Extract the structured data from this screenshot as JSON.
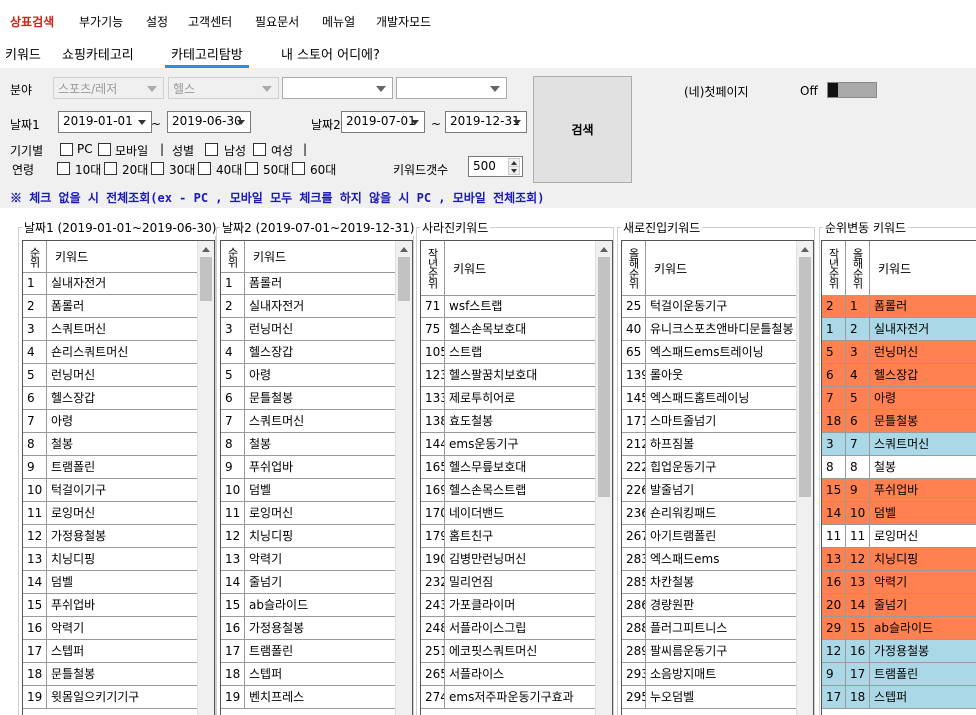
{
  "menu": [
    "상표검색",
    "부가기능",
    "설정",
    "고객센터",
    "필요문서",
    "메뉴얼",
    "개발자모드"
  ],
  "tabs": [
    "키워드",
    "쇼핑카테고리",
    "카테고리탐방",
    "내 스토어 어디에?"
  ],
  "form": {
    "field_label": "분야",
    "field1": "스포츠/레저",
    "field2": "헬스",
    "field3": "",
    "field4": "",
    "date1_label": "날짜1",
    "date1_from": "2019-01-01",
    "date1_to": "2019-06-30",
    "date2_label": "날짜2",
    "date2_from": "2019-07-01",
    "date2_to": "2019-12-31",
    "tilde": "~",
    "device_label": "기기별",
    "pc": "PC",
    "mobile": "모바일",
    "sep": "|",
    "gender_label": "성별",
    "male": "남성",
    "female": "여성",
    "age_label": "연령",
    "ages": [
      "10대",
      "20대",
      "30대",
      "40대",
      "50대",
      "60대"
    ],
    "kwcount_label": "키워드갯수",
    "kwcount": "500",
    "search_btn": "검색",
    "firstpage_label": "(네)첫페이지",
    "toggle_state": "Off"
  },
  "note": "※ 체크 없을 시 전체조회(ex - PC , 모바일 모두 체크를 하지 않을 시 PC , 모바일 전체조회)",
  "groups": {
    "g1": "날짜1 (2019-01-01~2019-06-30)",
    "g2": "날짜2 (2019-07-01~2019-12-31)",
    "g3": "사라진키워드",
    "g4": "새로진입키워드",
    "g5": "순위변동 키워드"
  },
  "headers": {
    "rank": "순위",
    "keyword": "키워드",
    "lastyear_rank": "작년순위",
    "thisyear_rank": "올해순위"
  },
  "grid1": [
    [
      "1",
      "실내자전거"
    ],
    [
      "2",
      "폼롤러"
    ],
    [
      "3",
      "스쿼트머신"
    ],
    [
      "4",
      "숀리스쿼트머신"
    ],
    [
      "5",
      "런닝머신"
    ],
    [
      "6",
      "헬스장갑"
    ],
    [
      "7",
      "아령"
    ],
    [
      "8",
      "철봉"
    ],
    [
      "9",
      "트램폴린"
    ],
    [
      "10",
      "턱걸이기구"
    ],
    [
      "11",
      "로잉머신"
    ],
    [
      "12",
      "가정용철봉"
    ],
    [
      "13",
      "치닝디핑"
    ],
    [
      "14",
      "덤벨"
    ],
    [
      "15",
      "푸쉬업바"
    ],
    [
      "16",
      "악력기"
    ],
    [
      "17",
      "스텝퍼"
    ],
    [
      "18",
      "문틀철봉"
    ],
    [
      "19",
      "윗몸일으키기기구"
    ]
  ],
  "grid2": [
    [
      "1",
      "폼롤러"
    ],
    [
      "2",
      "실내자전거"
    ],
    [
      "3",
      "런닝머신"
    ],
    [
      "4",
      "헬스장갑"
    ],
    [
      "5",
      "아령"
    ],
    [
      "6",
      "문틀철봉"
    ],
    [
      "7",
      "스쿼트머신"
    ],
    [
      "8",
      "철봉"
    ],
    [
      "9",
      "푸쉬업바"
    ],
    [
      "10",
      "덤벨"
    ],
    [
      "11",
      "로잉머신"
    ],
    [
      "12",
      "치닝디핑"
    ],
    [
      "13",
      "악력기"
    ],
    [
      "14",
      "줄넘기"
    ],
    [
      "15",
      "ab슬라이드"
    ],
    [
      "16",
      "가정용철봉"
    ],
    [
      "17",
      "트램폴린"
    ],
    [
      "18",
      "스텝퍼"
    ],
    [
      "19",
      "벤치프레스"
    ]
  ],
  "grid3": [
    [
      "71",
      "wsf스트랩"
    ],
    [
      "75",
      "헬스손목보호대"
    ],
    [
      "105",
      "스트랩"
    ],
    [
      "123",
      "헬스팔꿈치보호대"
    ],
    [
      "133",
      "제로투히어로"
    ],
    [
      "138",
      "효도철봉"
    ],
    [
      "144",
      "ems운동기구"
    ],
    [
      "165",
      "헬스무릎보호대"
    ],
    [
      "169",
      "헬스손목스트랩"
    ],
    [
      "170",
      "네이더밴드"
    ],
    [
      "179",
      "홈트친구"
    ],
    [
      "190",
      "김병만런닝머신"
    ],
    [
      "232",
      "밀리언짐"
    ],
    [
      "243",
      "가포클라이머"
    ],
    [
      "248",
      "서플라이스그립"
    ],
    [
      "251",
      "에코핏스쿼트머신"
    ],
    [
      "265",
      "서플라이스"
    ],
    [
      "274",
      "ems저주파운동기구효과"
    ]
  ],
  "grid4": [
    [
      "25",
      "턱걸이운동기구"
    ],
    [
      "40",
      "유니크스포츠앤바디문틀철봉"
    ],
    [
      "65",
      "엑스패드ems트레이닝"
    ],
    [
      "139",
      "롤아웃"
    ],
    [
      "145",
      "엑스패드홈트레이닝"
    ],
    [
      "171",
      "스마트줄넘기"
    ],
    [
      "212",
      "하프짐볼"
    ],
    [
      "222",
      "힙업운동기구"
    ],
    [
      "226",
      "발줄넘기"
    ],
    [
      "236",
      "숀리워킹패드"
    ],
    [
      "267",
      "아기트램폴린"
    ],
    [
      "283",
      "엑스패드ems"
    ],
    [
      "285",
      "차칸철봉"
    ],
    [
      "286",
      "경량원판"
    ],
    [
      "288",
      "플러그피트니스"
    ],
    [
      "289",
      "팔씨름운동기구"
    ],
    [
      "293",
      "소음방지매트"
    ],
    [
      "295",
      "누오덤벨"
    ]
  ],
  "grid5": [
    [
      "2",
      "1",
      "폼롤러",
      "up"
    ],
    [
      "1",
      "2",
      "실내자전거",
      "down"
    ],
    [
      "5",
      "3",
      "런닝머신",
      "up"
    ],
    [
      "6",
      "4",
      "헬스장갑",
      "up"
    ],
    [
      "7",
      "5",
      "아령",
      "up"
    ],
    [
      "18",
      "6",
      "문틀철봉",
      "up"
    ],
    [
      "3",
      "7",
      "스쿼트머신",
      "down"
    ],
    [
      "8",
      "8",
      "철봉",
      "same"
    ],
    [
      "15",
      "9",
      "푸쉬업바",
      "up"
    ],
    [
      "14",
      "10",
      "덤벨",
      "up"
    ],
    [
      "11",
      "11",
      "로잉머신",
      "same"
    ],
    [
      "13",
      "12",
      "치닝디핑",
      "up"
    ],
    [
      "16",
      "13",
      "악력기",
      "up"
    ],
    [
      "20",
      "14",
      "줄넘기",
      "up"
    ],
    [
      "29",
      "15",
      "ab슬라이드",
      "up"
    ],
    [
      "12",
      "16",
      "가정용철봉",
      "down"
    ],
    [
      "9",
      "17",
      "트램폴린",
      "down"
    ],
    [
      "17",
      "18",
      "스텝퍼",
      "down"
    ]
  ],
  "colors": {
    "up": "#ff8050",
    "down": "#abd8e6",
    "same": "#ffffff",
    "menu_active": "#d4201a",
    "tab_underline": "#2e8fd6",
    "note": "#1a1ab8"
  }
}
